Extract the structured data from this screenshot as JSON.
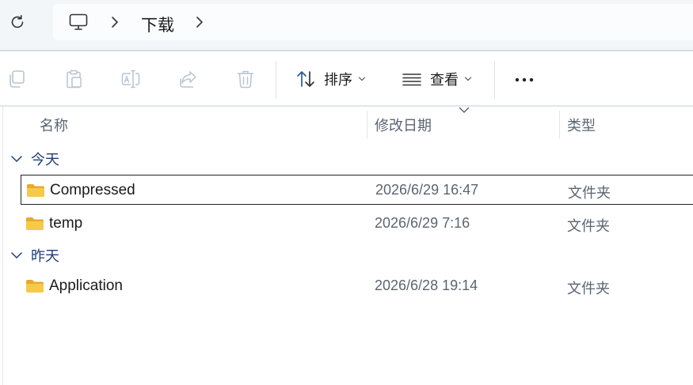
{
  "navigation": {
    "refresh_icon": "refresh-icon",
    "breadcrumb_root_icon": "this-pc-icon",
    "breadcrumb": [
      "下载"
    ]
  },
  "toolbar": {
    "copy_icon": "copy-icon",
    "paste_icon": "paste-icon",
    "rename_icon": "rename-icon",
    "share_icon": "share-icon",
    "delete_icon": "delete-icon",
    "sort_label": "排序",
    "view_label": "查看",
    "more_icon": "more-icon"
  },
  "columns": {
    "name": "名称",
    "date": "修改日期",
    "type": "类型"
  },
  "groups": [
    {
      "label": "今天",
      "items": [
        {
          "name": "Compressed",
          "date": "2026/6/29 16:47",
          "type": "文件夹",
          "selected": true
        },
        {
          "name": "temp",
          "date": "2026/6/29 7:16",
          "type": "文件夹",
          "selected": false
        }
      ]
    },
    {
      "label": "昨天",
      "items": [
        {
          "name": "Application",
          "date": "2026/6/28 19:14",
          "type": "文件夹",
          "selected": false
        }
      ]
    }
  ],
  "colors": {
    "accent": "#1f3d78",
    "folder": "#f6c94a",
    "address_bar_bg": "#f3f6f9"
  }
}
